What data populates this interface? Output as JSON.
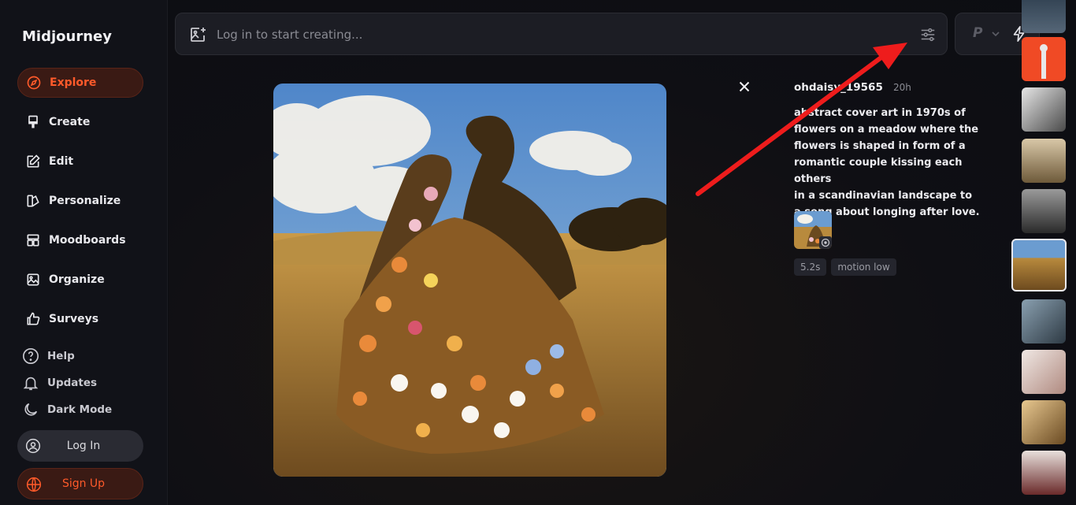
{
  "app": {
    "title": "Midjourney"
  },
  "sidebar": {
    "items": [
      {
        "label": "Explore",
        "icon": "compass-icon"
      },
      {
        "label": "Create",
        "icon": "brush-icon"
      },
      {
        "label": "Edit",
        "icon": "edit-icon"
      },
      {
        "label": "Personalize",
        "icon": "personalize-icon"
      },
      {
        "label": "Moodboards",
        "icon": "moodboard-icon"
      },
      {
        "label": "Organize",
        "icon": "image-icon"
      },
      {
        "label": "Surveys",
        "icon": "thumbs-up-icon"
      }
    ],
    "secondary": [
      {
        "label": "Help",
        "icon": "help-icon"
      },
      {
        "label": "Updates",
        "icon": "bell-icon"
      },
      {
        "label": "Dark Mode",
        "icon": "moon-icon"
      }
    ],
    "login": "Log In",
    "signup": "Sign Up"
  },
  "search": {
    "placeholder": "Log in to start creating..."
  },
  "mode": {
    "label": "P"
  },
  "detail": {
    "username": "ohdaisy_19565",
    "time": "20h",
    "prompt": "abstract cover art in 1970s of\nflowers on a meadow where the\nflowers is shaped in form of a\nromantic couple kissing each others\nin a scandinavian landscape to\na song about longing after love.",
    "tags": [
      "5.2s",
      "motion low"
    ]
  },
  "colors": {
    "accent": "#ff5a2a",
    "background": "#0d0e13",
    "annotation_arrow": "#ee1c1c"
  }
}
